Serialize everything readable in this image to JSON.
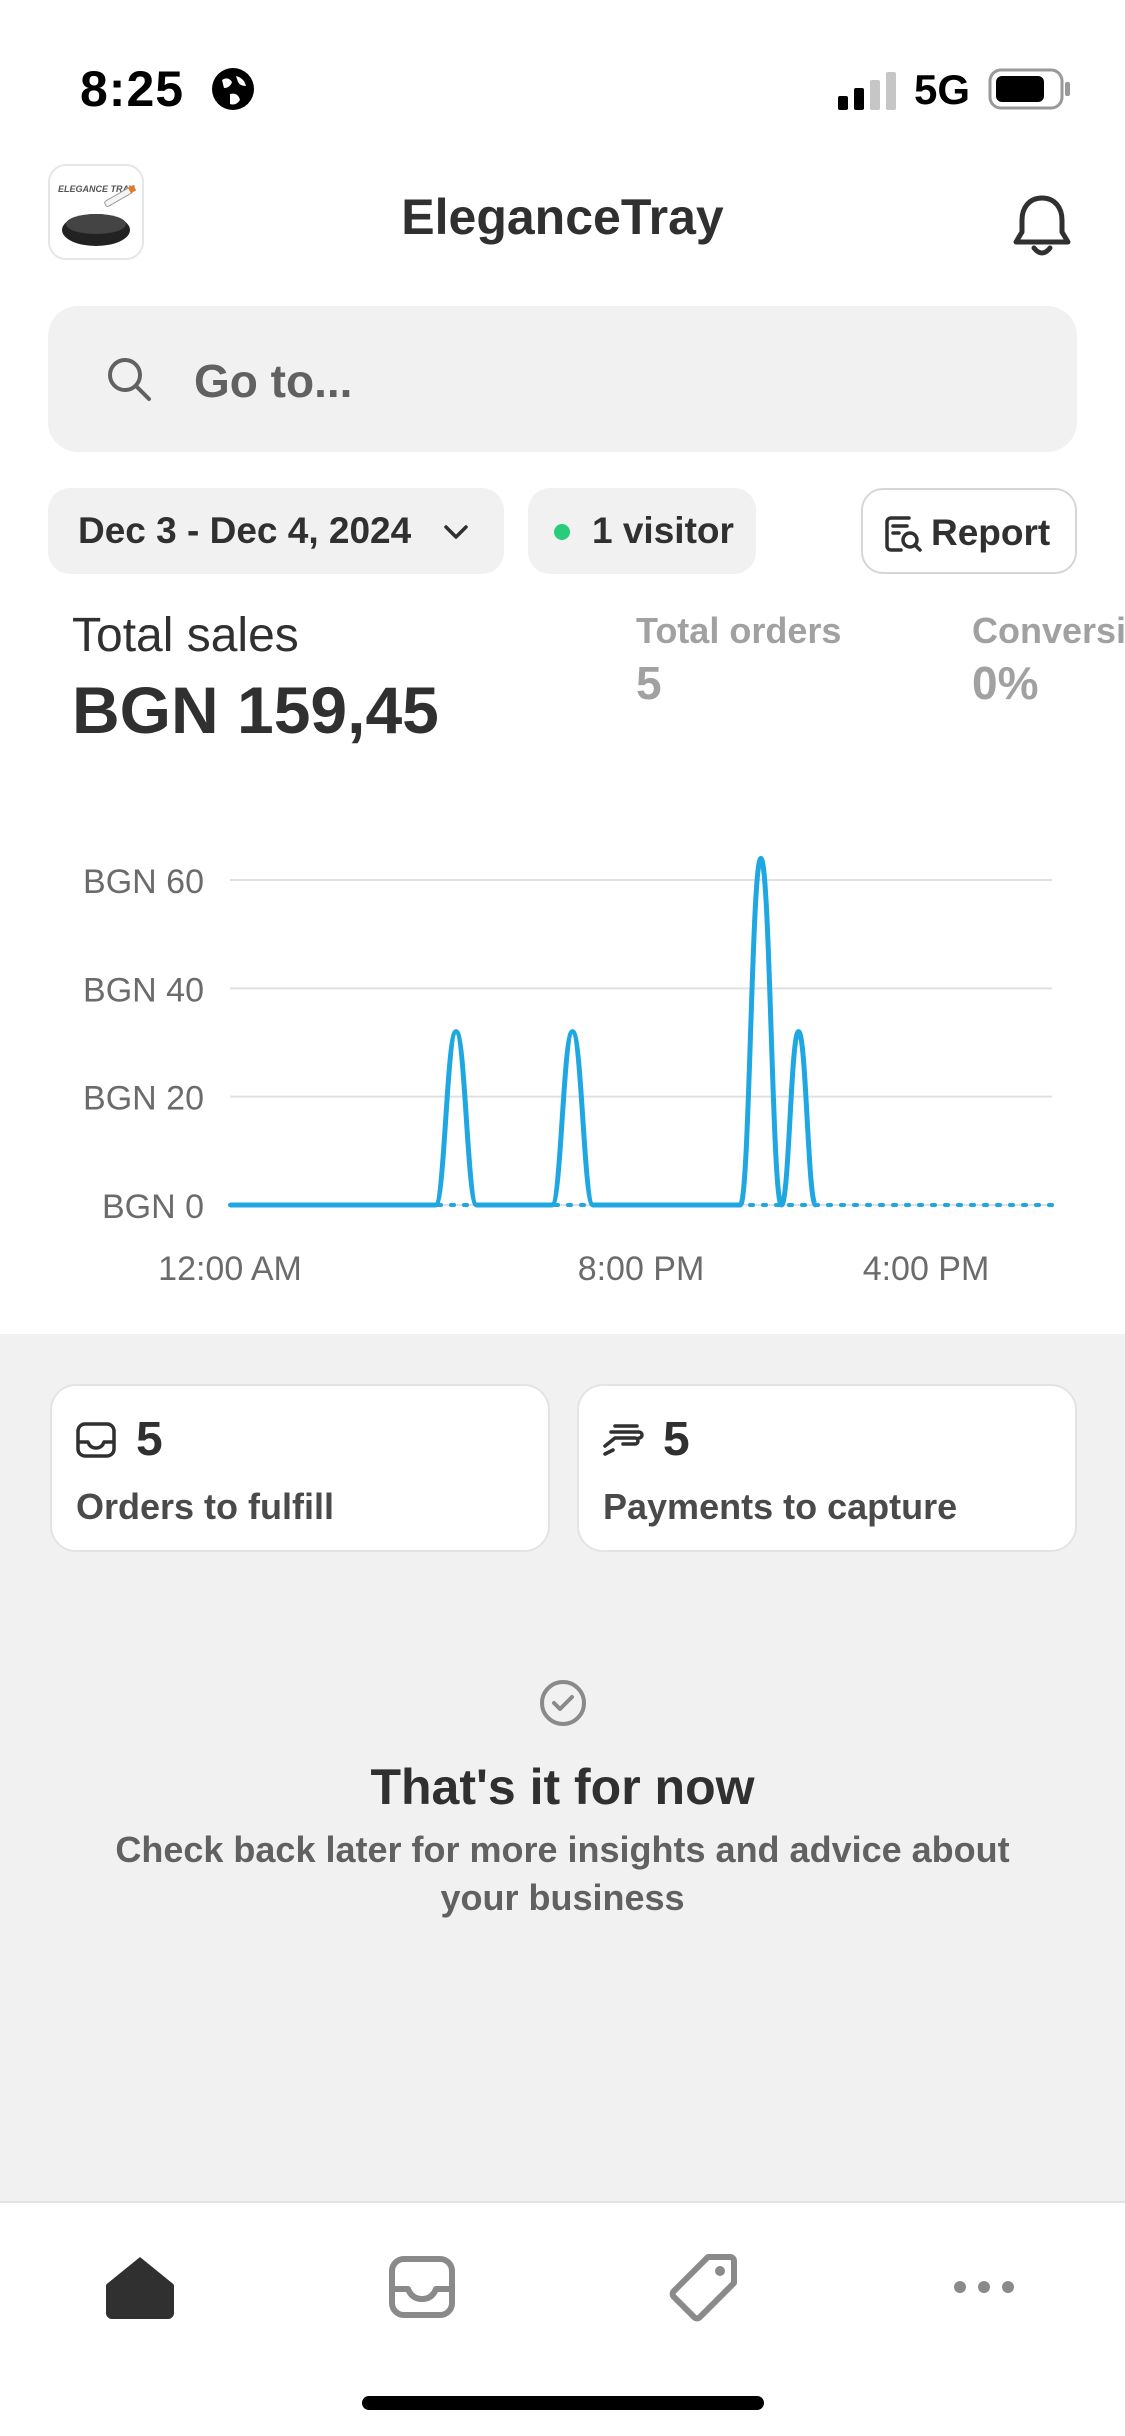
{
  "status_bar": {
    "time": "8:25",
    "network": "5G",
    "icons": [
      "globe-icon",
      "cellular-signal-icon",
      "battery-icon"
    ]
  },
  "header": {
    "logo_text": "ELEGANCE TRAY",
    "title": "EleganceTray",
    "icon": "bell-icon"
  },
  "search": {
    "placeholder": "Go to..."
  },
  "filters": {
    "date_range": "Dec 3 - Dec 4, 2024",
    "visitors": "1 visitor",
    "report_label": "Report",
    "visitor_dot_color": "#29cc7a"
  },
  "metrics": {
    "total_sales_label": "Total sales",
    "total_sales_value": "BGN 159,45",
    "total_orders_label": "Total orders",
    "total_orders_value": "5",
    "conversion_label": "Conversi",
    "conversion_value": "0%"
  },
  "chart_data": {
    "type": "line",
    "y_tick_labels": [
      "BGN 60",
      "BGN 40",
      "BGN 20",
      "BGN 0"
    ],
    "y_ticks": [
      60,
      40,
      20,
      0
    ],
    "ylim": [
      0,
      60
    ],
    "x_tick_labels": [
      "12:00 AM",
      "8:00 PM",
      "4:00 PM"
    ],
    "grid": true,
    "series": [
      {
        "color": "#1ea7e1",
        "style": "solid",
        "x_hours": [
          0,
          6,
          6.6,
          7.2,
          9.4,
          10,
          10.6,
          14.9,
          15.5,
          16.1,
          16.6,
          17.1
        ],
        "values": [
          0,
          0,
          32,
          0,
          0,
          32,
          0,
          0,
          64,
          0,
          32,
          0
        ]
      },
      {
        "color": "#1ea7e1",
        "style": "dotted",
        "x_hours": [
          0,
          24
        ],
        "values": [
          0,
          0
        ]
      }
    ],
    "x_range_hours": [
      0,
      24
    ]
  },
  "tasks": [
    {
      "count": "5",
      "label": "Orders to fulfill",
      "icon": "inbox-icon"
    },
    {
      "count": "5",
      "label": "Payments to capture",
      "icon": "payment-hand-icon"
    }
  ],
  "empty_state": {
    "title": "That's it for now",
    "text": "Check back later for more insights and advice about your business",
    "icon": "check-circle-icon"
  },
  "tab_bar": {
    "items": [
      "home-icon",
      "inbox-icon",
      "tag-icon",
      "more-icon"
    ],
    "active": "home-icon"
  }
}
